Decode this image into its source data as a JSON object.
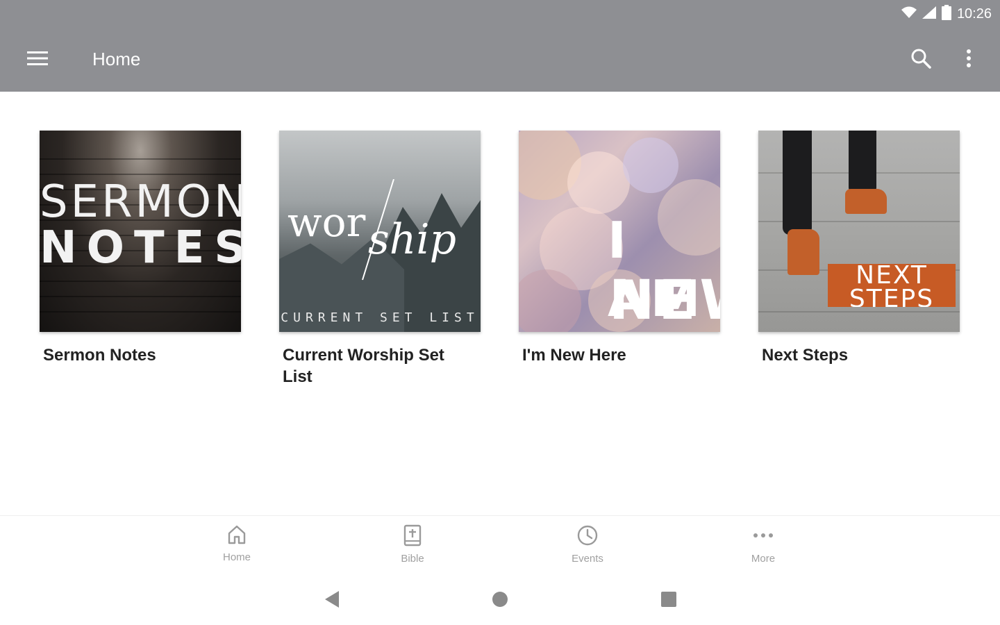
{
  "status_bar": {
    "time": "10:26"
  },
  "app_bar": {
    "title": "Home"
  },
  "tiles": [
    {
      "label": "Sermon Notes",
      "art_line1": "SERMON",
      "art_line2": "NOTES"
    },
    {
      "label": "Current Worship Set List",
      "art_script1": "wor",
      "art_script2": "ship",
      "art_caption": "CURRENT SET LIST"
    },
    {
      "label": "I'm New Here",
      "art_line1": "I AM",
      "art_line2": "NEW"
    },
    {
      "label": "Next Steps",
      "art_line1": "NEXT",
      "art_line2": "STEPS"
    }
  ],
  "bottom_nav": [
    {
      "label": "Home",
      "icon": "home-icon"
    },
    {
      "label": "Bible",
      "icon": "bible-icon"
    },
    {
      "label": "Events",
      "icon": "clock-icon"
    },
    {
      "label": "More",
      "icon": "more-horizontal-icon"
    }
  ],
  "colors": {
    "app_bar": "#8e8f93",
    "nav_inactive": "#a0a0a0",
    "next_steps_orange": "#c75b25"
  }
}
